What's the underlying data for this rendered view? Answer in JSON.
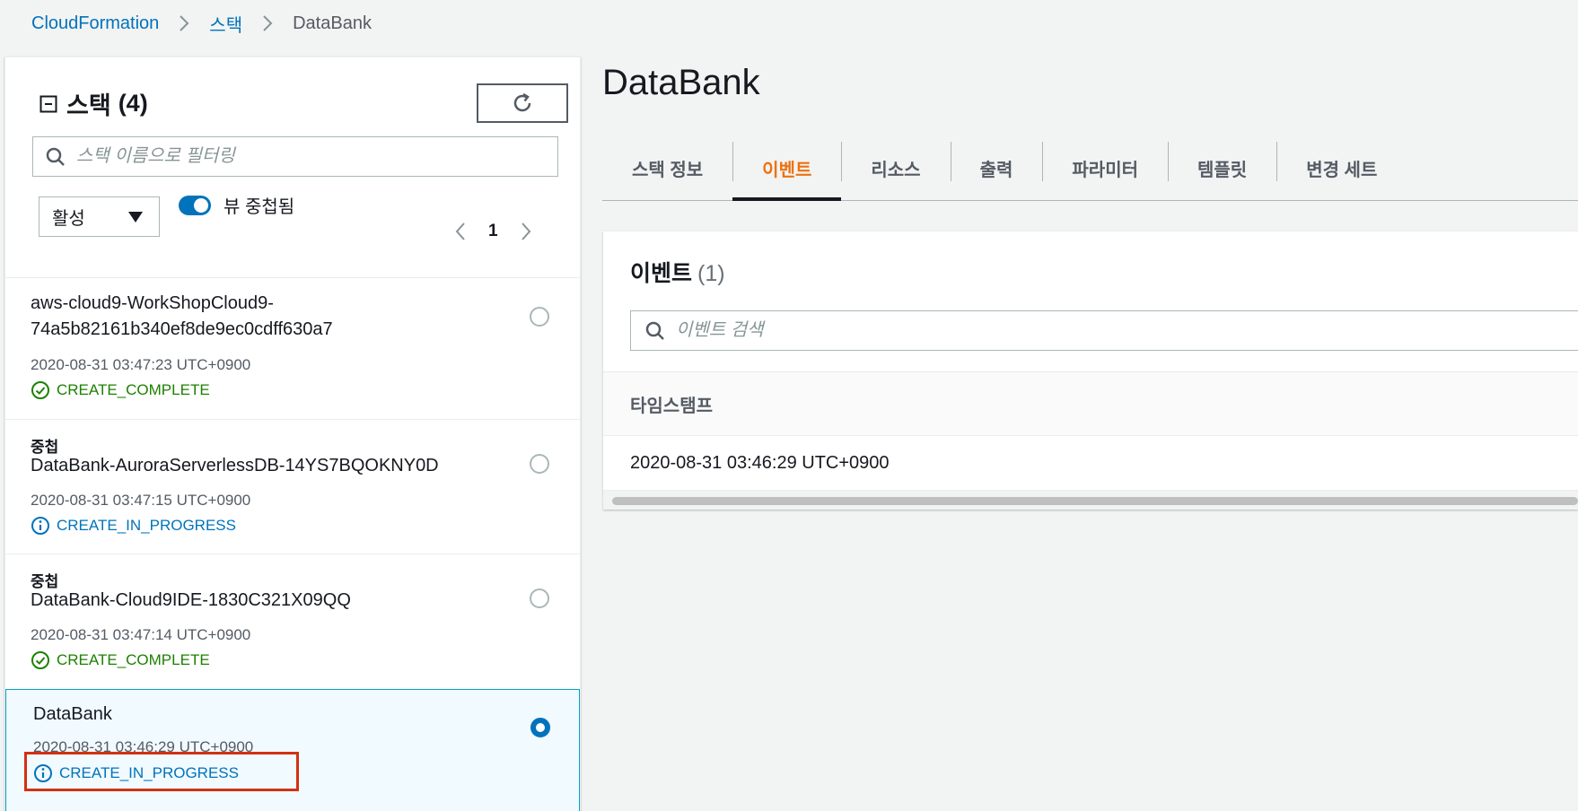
{
  "breadcrumb": {
    "root": "CloudFormation",
    "stacks": "스택",
    "current": "DataBank"
  },
  "left_panel": {
    "title": "스택",
    "count": "(4)",
    "filter_placeholder": "스택 이름으로 필터링",
    "status_filter": "활성",
    "nested_view_label": "뷰 중첩됨",
    "page": "1",
    "stacks": [
      {
        "nested_label": "",
        "name": "aws-cloud9-WorkShopCloud9-74a5b82161b340ef8de9ec0cdff630a7",
        "timestamp": "2020-08-31 03:47:23 UTC+0900",
        "status": "CREATE_COMPLETE"
      },
      {
        "nested_label": "중첩",
        "name": "DataBank-AuroraServerlessDB-14YS7BQOKNY0D",
        "timestamp": "2020-08-31 03:47:15 UTC+0900",
        "status": "CREATE_IN_PROGRESS"
      },
      {
        "nested_label": "중첩",
        "name": "DataBank-Cloud9IDE-1830C321X09QQ",
        "timestamp": "2020-08-31 03:47:14 UTC+0900",
        "status": "CREATE_COMPLETE"
      },
      {
        "nested_label": "",
        "name": "DataBank",
        "timestamp": "2020-08-31 03:46:29 UTC+0900",
        "status": "CREATE_IN_PROGRESS",
        "selected": true
      }
    ]
  },
  "main": {
    "title": "DataBank",
    "tabs": [
      {
        "label": "스택 정보"
      },
      {
        "label": "이벤트",
        "active": true
      },
      {
        "label": "리소스"
      },
      {
        "label": "출력"
      },
      {
        "label": "파라미터"
      },
      {
        "label": "템플릿"
      },
      {
        "label": "변경 세트"
      }
    ],
    "events": {
      "title": "이벤트",
      "count": "(1)",
      "search_placeholder": "이벤트 검색",
      "column_timestamp": "타임스탬프",
      "rows": [
        {
          "timestamp": "2020-08-31 03:46:29 UTC+0900"
        }
      ]
    }
  },
  "colors": {
    "link": "#0073bb",
    "active_tab": "#ec7211",
    "complete": "#1d8102",
    "in_progress": "#0073bb",
    "highlight": "#d13212"
  }
}
